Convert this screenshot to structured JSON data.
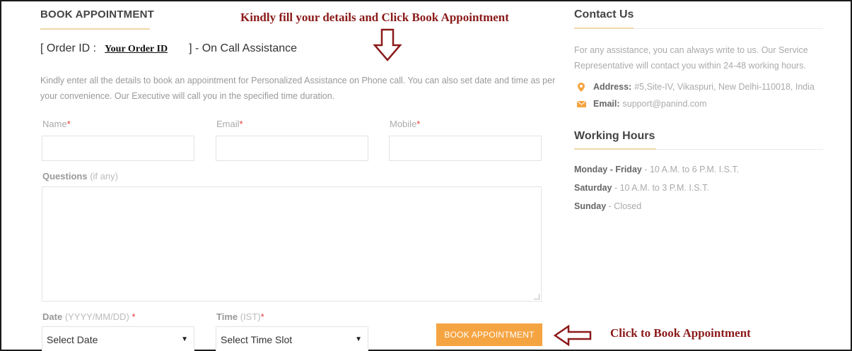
{
  "form": {
    "title": "BOOK APPOINTMENT",
    "order_prefix": "[ Order ID :",
    "order_id": "Your Order ID",
    "order_suffix": "] - On Call Assistance",
    "intro": "Kindly enter all the details to book an appointment for Personalized Assistance on Phone call. You can also set date and time as per your convenience. Our Executive will call you in the specified time duration.",
    "name_label": "Name",
    "email_label": "Email",
    "mobile_label": "Mobile",
    "required_mark": "*",
    "questions_label": "Questions",
    "questions_hint": "(if any)",
    "date_label": "Date",
    "date_hint": "(YYYY/MM/DD)",
    "time_label": "Time",
    "time_hint": "(IST)",
    "date_select": "Select Date",
    "time_select": "Select Time Slot",
    "submit_label": "BOOK APPOINTMENT"
  },
  "annotations": {
    "top": "Kindly fill your details and Click Book Appointment",
    "bottom": "Click to Book Appointment"
  },
  "contact": {
    "title": "Contact Us",
    "text": "For any assistance, you can always write to us. Our Service Representative will contact you within 24-48 working hours.",
    "address_label": "Address:",
    "address_value": "#5,Site-IV, Vikaspuri, New Delhi-110018, India",
    "email_label": "Email:",
    "email_value": "support@panind.com"
  },
  "hours": {
    "title": "Working Hours",
    "rows": [
      {
        "day": "Monday - Friday",
        "time": " - 10 A.M. to 6 P.M. I.S.T."
      },
      {
        "day": "Saturday",
        "time": " - 10 A.M. to 3 P.M. I.S.T."
      },
      {
        "day": "Sunday",
        "time": " - Closed"
      }
    ]
  },
  "colors": {
    "accent": "#f5a442",
    "annotation": "#8b1a1a",
    "required": "#e53935"
  },
  "icons": [
    "map-pin-icon",
    "envelope-icon",
    "arrow-down-annotation-icon",
    "arrow-left-annotation-icon",
    "caret-down-icon"
  ]
}
